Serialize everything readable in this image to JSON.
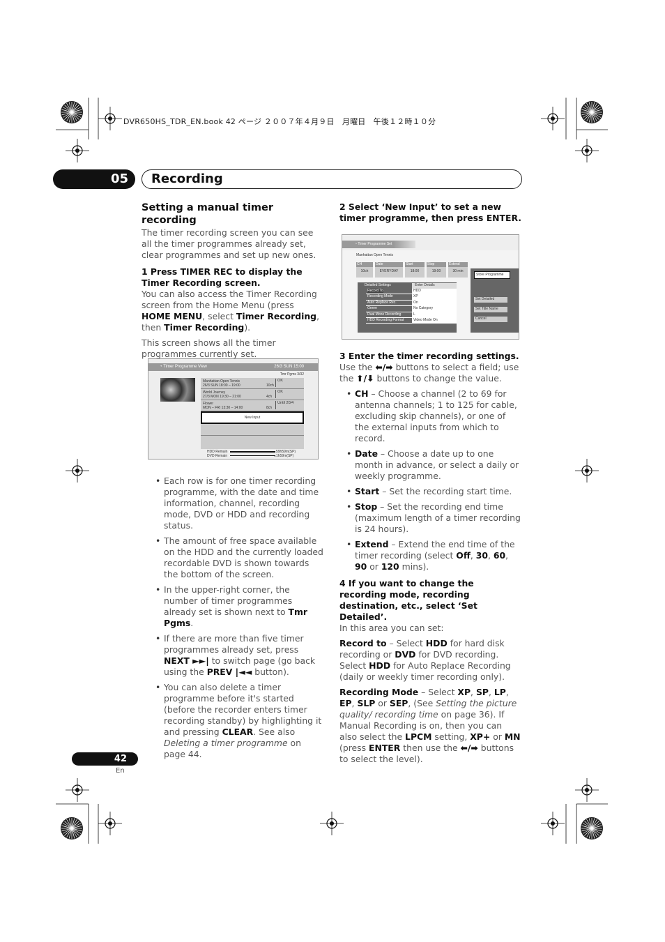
{
  "header": {
    "book_line": "DVR650HS_TDR_EN.book  42 ページ  ２００７年４月９日　月曜日　午後１２時１０分",
    "chapter_number": "05",
    "chapter_title": "Recording"
  },
  "left": {
    "title": "Setting a manual timer recording",
    "intro": "The timer recording screen you can see all the timer programmes already set, clear programmes and set up new ones.",
    "step1_title": "1    Press TIMER REC to display the Timer Recording screen.",
    "step1_p1": [
      {
        "t": "You can also access the Timer Recording screen from the Home Menu (press "
      },
      {
        "t": "HOME MENU",
        "b": 1
      },
      {
        "t": ", select "
      },
      {
        "t": "Timer Recording",
        "b": 1
      },
      {
        "t": ", then "
      },
      {
        "t": "Timer Recording",
        "b": 1
      },
      {
        "t": ")."
      }
    ],
    "step1_p2": "This screen shows all the timer programmes currently set.",
    "bullets": [
      [
        {
          "t": "Each row is for one timer recording programme, with the date and time information, channel, recording mode, DVD or HDD and recording status."
        }
      ],
      [
        {
          "t": "The amount of free space available on the HDD and the currently loaded recordable DVD is shown towards the bottom of the screen."
        }
      ],
      [
        {
          "t": "In the upper-right corner, the number of timer programmes already set is shown next to "
        },
        {
          "t": "Tmr Pgms",
          "b": 1
        },
        {
          "t": "."
        }
      ],
      [
        {
          "t": "If there are more than five timer programmes already set, press "
        },
        {
          "t": "NEXT ►►|",
          "b": 1
        },
        {
          "t": " to switch page (go back using the "
        },
        {
          "t": "PREV |◄◄",
          "b": 1
        },
        {
          "t": " button)."
        }
      ],
      [
        {
          "t": "You can also delete a timer programme before it's started (before the recorder enters timer recording standby) by highlighting it and pressing "
        },
        {
          "t": "CLEAR",
          "b": 1
        },
        {
          "t": ". See also "
        },
        {
          "t": "Deleting a timer programme",
          "i": 1
        },
        {
          "t": " on page 44."
        }
      ]
    ]
  },
  "screen1": {
    "title": "Timer Programme View",
    "datetime": "26/3 SUN 15:00",
    "tmr_pgms": "Tmr Pgms  3/32",
    "rows": [
      {
        "name": "Manhattan Open Tennis",
        "when": "26/3 SUN    18:00 – 19:00",
        "ch": "10ch",
        "status": "OK"
      },
      {
        "name": "World Journey",
        "when": "27/3 MON    19:30 – 21:00",
        "ch": "4ch",
        "status": "OK"
      },
      {
        "name": "Flower",
        "when": "MON – FRI  13:30 – 14:00",
        "ch": "8ch",
        "status": "Until 20/4"
      }
    ],
    "new_input": "New Input",
    "hdd_label": "HDD Remain",
    "dvd_label": "DVD Remain",
    "hdd_value": "59h59m(SP)",
    "dvd_value": "1h59m(SP)",
    "hdd_fill": 0.92,
    "dvd_fill": 0.02
  },
  "right": {
    "step2_title": "2    Select ‘New Input’ to set a new timer programme, then press ENTER.",
    "step3_title": "3    Enter the timer recording settings.",
    "step3_p": [
      {
        "t": "Use the "
      },
      {
        "t": "⬅/➡",
        "b": 1
      },
      {
        "t": " buttons to select a field; use the "
      },
      {
        "t": "⬆/⬇",
        "b": 1
      },
      {
        "t": " buttons to change the value."
      }
    ],
    "bullets": [
      [
        {
          "t": "CH",
          "b": 1
        },
        {
          "t": " – Choose a channel (2 to 69 for antenna channels; 1 to 125 for cable, excluding skip channels), or one of the external inputs from which to record."
        }
      ],
      [
        {
          "t": "Date",
          "b": 1
        },
        {
          "t": " – Choose a date up to one month in advance, or select a daily or weekly programme."
        }
      ],
      [
        {
          "t": "Start",
          "b": 1
        },
        {
          "t": " – Set the recording start time."
        }
      ],
      [
        {
          "t": "Stop",
          "b": 1
        },
        {
          "t": " – Set the recording end time (maximum length of a timer recording is 24 hours)."
        }
      ],
      [
        {
          "t": "Extend",
          "b": 1
        },
        {
          "t": " – Extend the end time of the timer recording (select "
        },
        {
          "t": "Off",
          "b": 1
        },
        {
          "t": ", "
        },
        {
          "t": "30",
          "b": 1
        },
        {
          "t": ", "
        },
        {
          "t": "60",
          "b": 1
        },
        {
          "t": ", "
        },
        {
          "t": "90",
          "b": 1
        },
        {
          "t": " or "
        },
        {
          "t": "120",
          "b": 1
        },
        {
          "t": " mins)."
        }
      ]
    ],
    "step4_title": "4    If you want to change the recording mode, recording destination, etc., select ‘Set Detailed’.",
    "step4_intro": "In this area you can set:",
    "p_record_to": [
      {
        "t": "Record to",
        "b": 1
      },
      {
        "t": " – Select "
      },
      {
        "t": "HDD",
        "b": 1
      },
      {
        "t": " for hard disk recording or "
      },
      {
        "t": "DVD",
        "b": 1
      },
      {
        "t": " for DVD recording. Select "
      },
      {
        "t": "HDD",
        "b": 1
      },
      {
        "t": " for Auto Replace Recording (daily or weekly timer recording only)."
      }
    ],
    "p_rec_mode": [
      {
        "t": "Recording Mode",
        "b": 1
      },
      {
        "t": " – Select "
      },
      {
        "t": "XP",
        "b": 1
      },
      {
        "t": ", "
      },
      {
        "t": "SP",
        "b": 1
      },
      {
        "t": ", "
      },
      {
        "t": "LP",
        "b": 1
      },
      {
        "t": ", "
      },
      {
        "t": "EP",
        "b": 1
      },
      {
        "t": ", "
      },
      {
        "t": "SLP",
        "b": 1
      },
      {
        "t": " or "
      },
      {
        "t": "SEP",
        "b": 1
      },
      {
        "t": ", (See "
      },
      {
        "t": "Setting the picture quality/ recording time",
        "i": 1
      },
      {
        "t": " on page 36). If Manual Recording is on, then you can also select the "
      },
      {
        "t": "LPCM",
        "b": 1
      },
      {
        "t": " setting, "
      },
      {
        "t": "XP+",
        "b": 1
      },
      {
        "t": " or "
      },
      {
        "t": "MN",
        "b": 1
      },
      {
        "t": " (press "
      },
      {
        "t": "ENTER",
        "b": 1
      },
      {
        "t": " then use the "
      },
      {
        "t": "⬅/➡",
        "b": 1
      },
      {
        "t": " buttons to select the level)."
      }
    ]
  },
  "screen2": {
    "title": "Timer Programme Set",
    "programme": "Manhattan Open Tennis",
    "fields": [
      {
        "label": "CH",
        "value": "10ch"
      },
      {
        "label": "Date",
        "value": "EVERYDAY"
      },
      {
        "label": "Start",
        "value": "18:00"
      },
      {
        "label": "Stop",
        "value": "19:00"
      },
      {
        "label": "Extend",
        "value": "30 min"
      }
    ],
    "detailed_header": "Detailed Settings",
    "enter_details": "Enter Details",
    "settings": [
      {
        "label": "Record To",
        "value": "HDD"
      },
      {
        "label": "Recording Mode",
        "value": "XP"
      },
      {
        "label": "Auto Replace Rec.",
        "value": "On"
      },
      {
        "label": "Genre",
        "value": "No Category"
      },
      {
        "label": "Dual Mono Recording",
        "value": "L"
      },
      {
        "label": "HDD Recording Format",
        "value": "Video Mode On"
      }
    ],
    "store": "Store Programme",
    "buttons": [
      "Set Detailed",
      "Set Title Name",
      "Cancel"
    ]
  },
  "footer": {
    "page": "42",
    "lang": "En"
  }
}
